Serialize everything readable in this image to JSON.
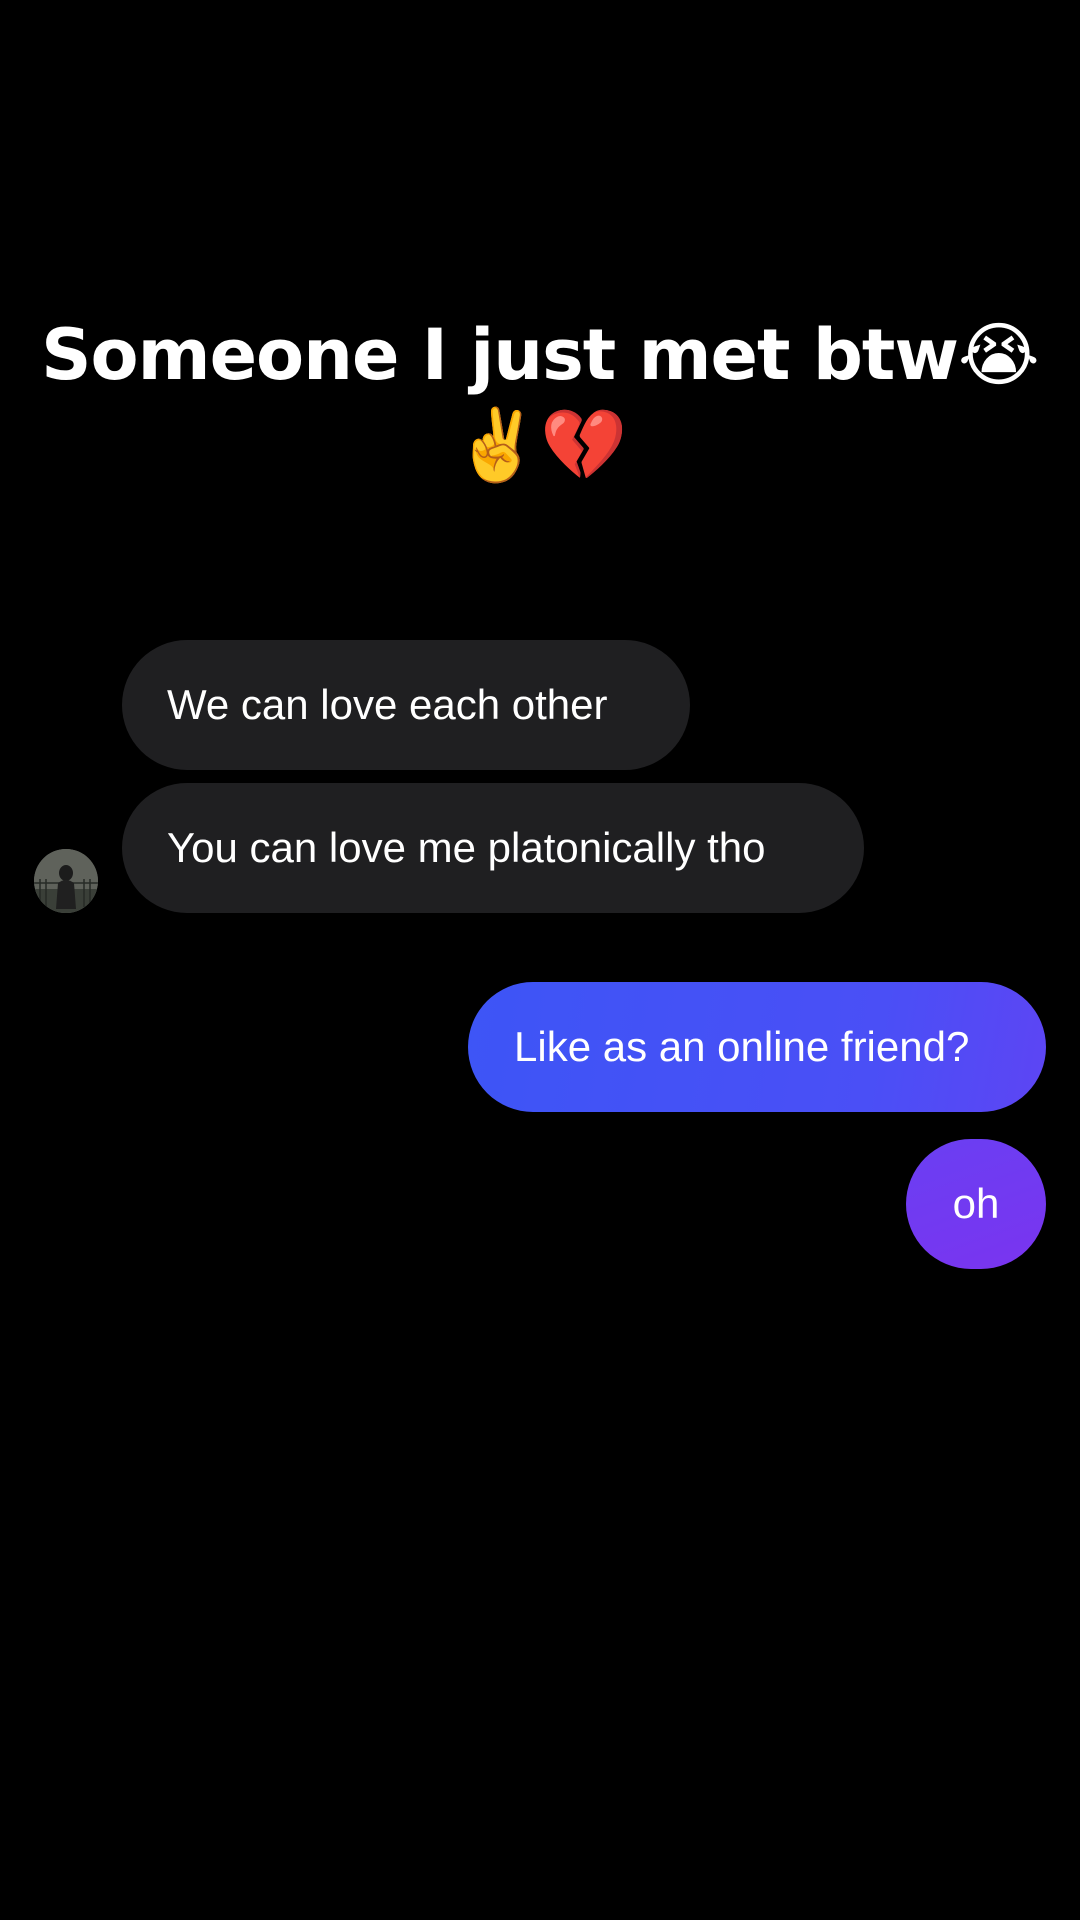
{
  "caption": {
    "line1": "Someone I just met btw😭",
    "line2": "✌️💔"
  },
  "messages": [
    {
      "direction": "incoming",
      "text": "We can love each other"
    },
    {
      "direction": "incoming",
      "text": "You can love me platonically tho"
    },
    {
      "direction": "outgoing",
      "text": "Like as an online friend?"
    },
    {
      "direction": "outgoing",
      "text": "oh"
    }
  ],
  "colors": {
    "background": "#000000",
    "incoming_bubble": "#1f1f21",
    "outgoing_bubble_start": "#3d55f6",
    "outgoing_bubble_end": "#7a34f0",
    "text": "#ffffff"
  },
  "avatar": {
    "icon": "profile-photo-avatar"
  }
}
